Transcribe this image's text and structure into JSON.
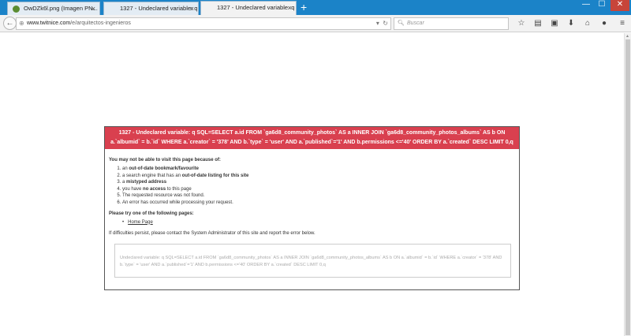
{
  "tabs": [
    {
      "label": "OwDZk6l.png (Imagen PN...",
      "fav_color": "#4a7a2a"
    },
    {
      "label": "1327 - Undeclared variable: q S...",
      "fav_color": "#ffffff"
    },
    {
      "label": "1327 - Undeclared variable: q S...",
      "fav_color": "#ffffff"
    }
  ],
  "window_controls": {
    "minimize": "—",
    "maximize": "☐",
    "close": "✕"
  },
  "url": {
    "domain": "www.twitnice.com",
    "path": "/e/arquitectos-ingenieros"
  },
  "search": {
    "placeholder": "Buscar"
  },
  "error": {
    "header": "1327 - Undeclared variable: q SQL=SELECT a.id FROM `ga6d8_community_photos` AS a INNER JOIN `ga6d8_community_photos_albums` AS b ON a.`albumid` = b.`id` WHERE a.`creator` = '378' AND b.`type` = 'user' AND a.`published`='1' AND b.permissions <='40' ORDER BY a.`created` DESC LIMIT 0,q",
    "intro": "You may not be able to visit this page because of:",
    "reasons": [
      {
        "pre": "an ",
        "bold": "out-of-date bookmark/favourite",
        "post": ""
      },
      {
        "pre": "a search engine that has an ",
        "bold": "out-of-date listing for this site",
        "post": ""
      },
      {
        "pre": "a ",
        "bold": "mistyped address",
        "post": ""
      },
      {
        "pre": "you have ",
        "bold": "no access",
        "post": " to this page"
      },
      {
        "pre": "The requested resource was not found.",
        "bold": "",
        "post": ""
      },
      {
        "pre": "An error has occurred while processing your request.",
        "bold": "",
        "post": ""
      }
    ],
    "try_text": "Please try one of the following pages:",
    "home_link": "Home Page",
    "contact": "If difficulties persist, please contact the System Administrator of this site and report the error below.",
    "detail": "Undeclared variable: q SQL=SELECT a.id FROM `ga6d8_community_photos` AS a INNER JOIN `ga6d8_community_photos_albums` AS b ON a.`albumid` = b.`id` WHERE a.`creator` = '378' AND b.`type` = 'user' AND a.`published`='1' AND b.permissions <='40' ORDER BY a.`created` DESC LIMIT 0,q"
  }
}
